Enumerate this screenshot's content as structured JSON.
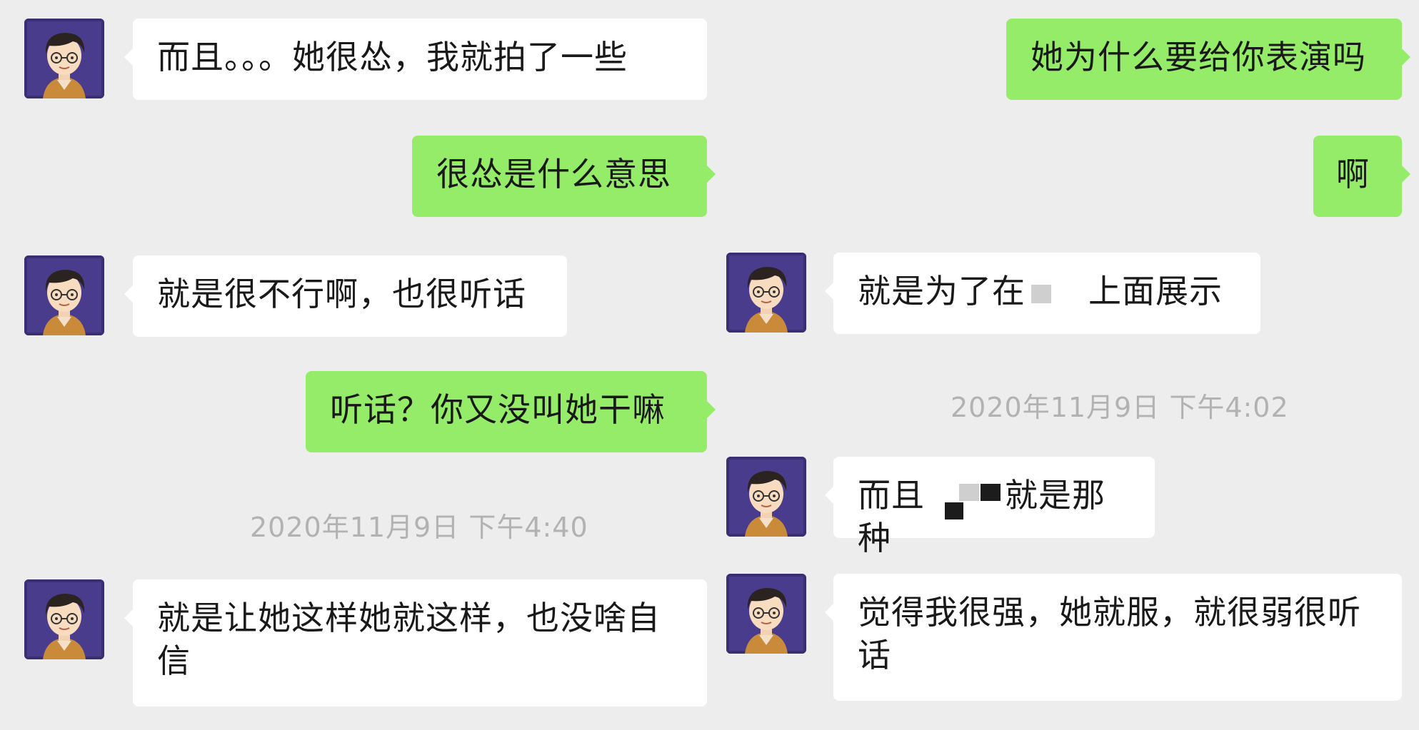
{
  "left_column": {
    "messages": [
      {
        "side": "received",
        "text": "而且。。。她很怂，我就拍了一些"
      },
      {
        "side": "sent",
        "text": "很怂是什么意思"
      },
      {
        "side": "received",
        "text": "就是很不行啊，也很听话"
      },
      {
        "side": "sent",
        "text": "听话？你又没叫她干嘛"
      },
      {
        "timestamp": "2020年11月9日 下午4:40"
      },
      {
        "side": "received",
        "text_line1": "就是让她这样她就这样，也没啥自",
        "text_line2": "信"
      }
    ]
  },
  "right_column": {
    "messages": [
      {
        "side": "sent",
        "text": "她为什么要给你表演吗"
      },
      {
        "side": "sent",
        "text": "啊"
      },
      {
        "side": "received",
        "text_before": "就是为了在",
        "text_after": "上面展示"
      },
      {
        "timestamp": "2020年11月9日 下午4:02"
      },
      {
        "side": "received",
        "text_before": "而且",
        "text_after": "就是那种"
      },
      {
        "side": "received",
        "text_line1": "觉得我很强，她就服，就很弱很听",
        "text_line2": "话"
      }
    ]
  },
  "icons": {
    "avatar": "cartoon-man-with-glasses-avatar"
  },
  "colors": {
    "background": "#ededed",
    "sent_bubble": "#95ec69",
    "received_bubble": "#ffffff",
    "timestamp": "#b2b2b2"
  }
}
